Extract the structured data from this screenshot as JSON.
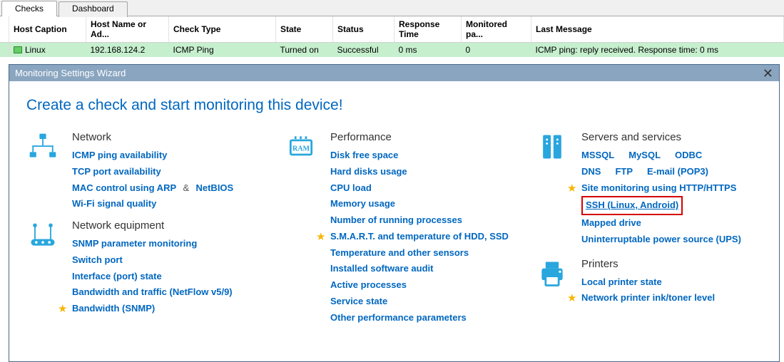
{
  "tabs": {
    "active": "Checks",
    "inactive": "Dashboard"
  },
  "table": {
    "headers": [
      "Host Caption",
      "Host Name or Ad...",
      "Check Type",
      "State",
      "Status",
      "Response Time",
      "Monitored pa...",
      "Last Message"
    ],
    "row": {
      "host_caption": "Linux",
      "host_name": "192.168.124.2",
      "check_type": "ICMP Ping",
      "state": "Turned on",
      "status": "Successful",
      "response_time": "0 ms",
      "monitored": "0",
      "last_message": "ICMP ping: reply received. Response time: 0 ms"
    }
  },
  "wizard": {
    "title": "Monitoring Settings Wizard",
    "heading": "Create a check and start monitoring this device!",
    "network": {
      "title": "Network",
      "items": [
        "ICMP ping availability",
        "TCP port availability",
        "MAC control using ARP",
        "NetBIOS",
        "Wi-Fi signal quality"
      ],
      "amp": "&"
    },
    "neteq": {
      "title": "Network equipment",
      "items": [
        "SNMP parameter monitoring",
        "Switch port",
        "Interface (port) state",
        "Bandwidth and traffic (NetFlow v5/9)",
        "Bandwidth (SNMP)"
      ]
    },
    "perf": {
      "title": "Performance",
      "items": [
        "Disk free space",
        "Hard disks usage",
        "CPU load",
        "Memory usage",
        "Number of running processes",
        "S.M.A.R.T. and temperature of HDD, SSD",
        "Temperature and other sensors",
        "Installed software audit",
        "Active processes",
        "Service state",
        "Other performance parameters"
      ]
    },
    "servers": {
      "title": "Servers and services",
      "row1": [
        "MSSQL",
        "MySQL",
        "ODBC"
      ],
      "row2": [
        "DNS",
        "FTP",
        "E-mail (POP3)"
      ],
      "items": [
        "Site monitoring using HTTP/HTTPS",
        "SSH (Linux, Android)",
        "Mapped drive",
        "Uninterruptable power source (UPS)"
      ]
    },
    "printers": {
      "title": "Printers",
      "items": [
        "Local printer state",
        "Network printer ink/toner level"
      ]
    }
  }
}
